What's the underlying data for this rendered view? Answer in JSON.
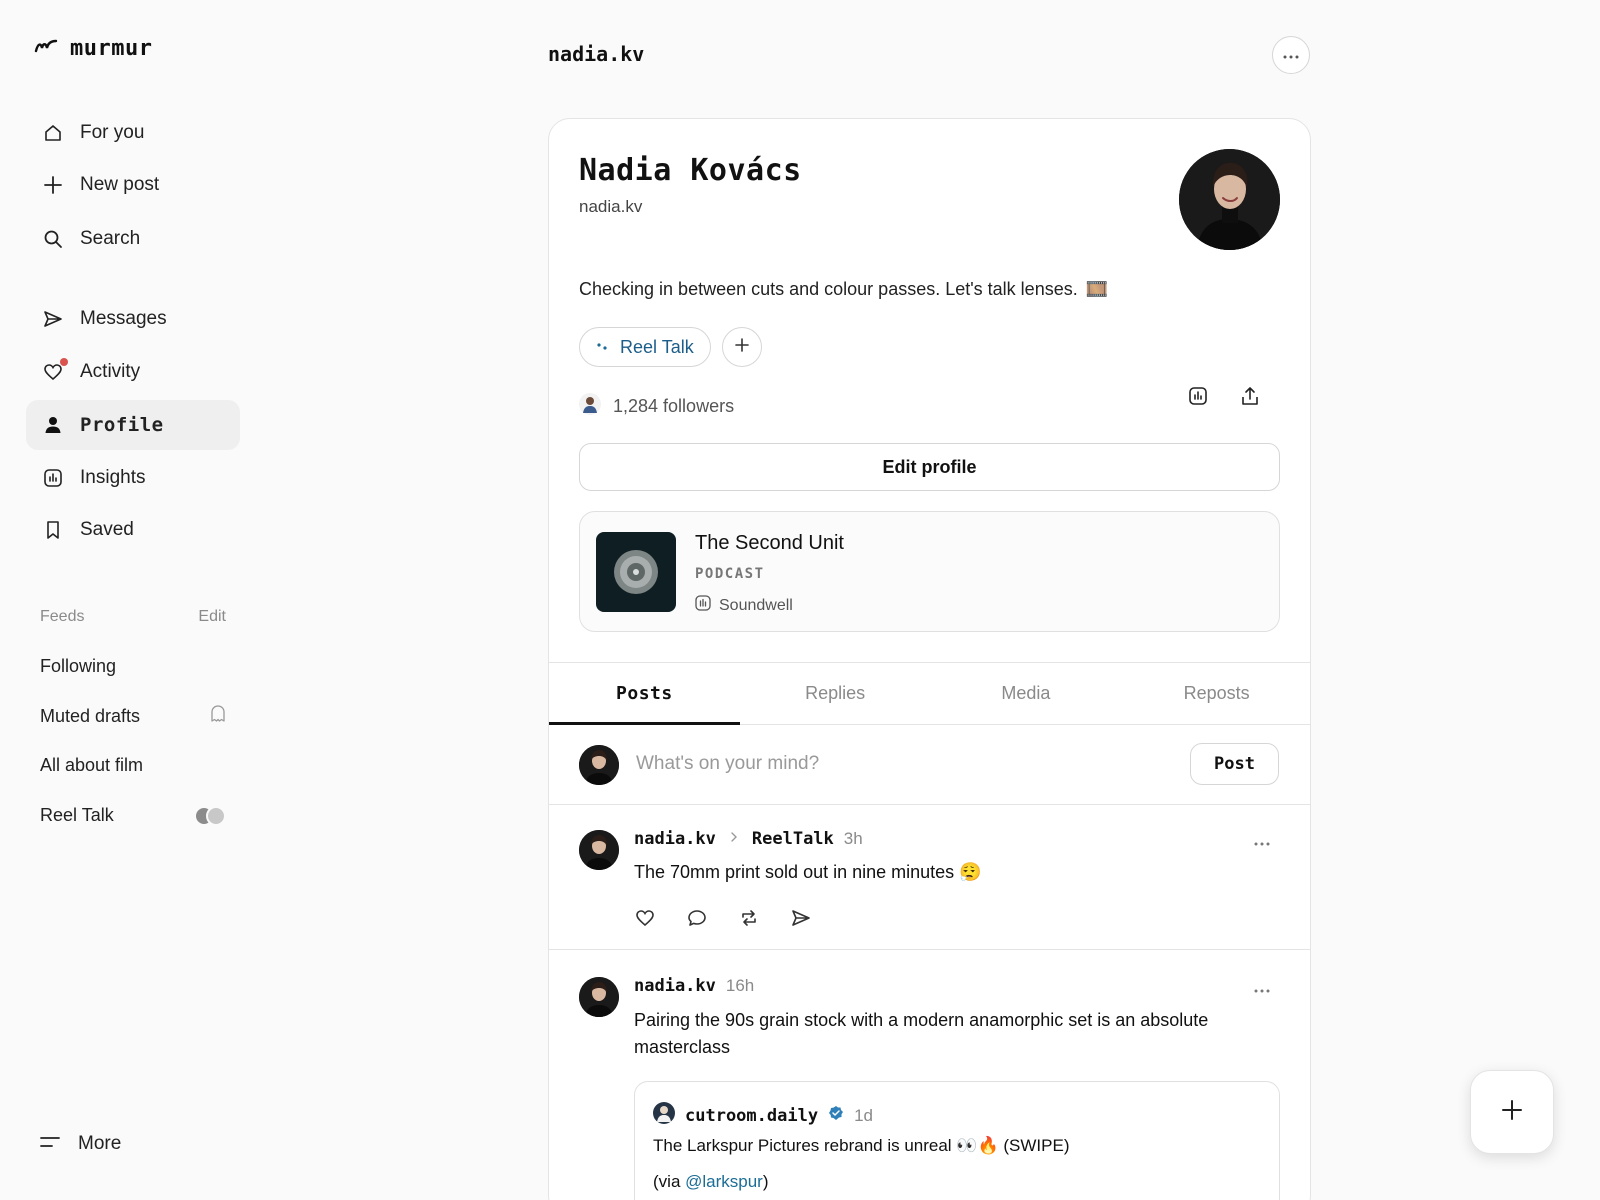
{
  "app": {
    "name": "murmur"
  },
  "nav": {
    "items": [
      {
        "label": "For you",
        "icon": "home-icon"
      },
      {
        "label": "New post",
        "icon": "plus-icon"
      },
      {
        "label": "Search",
        "icon": "search-icon"
      },
      {
        "label": "Messages",
        "icon": "send-icon"
      },
      {
        "label": "Activity",
        "icon": "heart-icon",
        "has_notification": true
      },
      {
        "label": "Profile",
        "icon": "person-icon",
        "active": true
      },
      {
        "label": "Insights",
        "icon": "chart-icon"
      },
      {
        "label": "Saved",
        "icon": "bookmark-icon"
      }
    ]
  },
  "feeds": {
    "heading": "Feeds",
    "edit_label": "Edit",
    "items": [
      {
        "label": "Following"
      },
      {
        "label": "Muted drafts",
        "icon": "ghost-icon"
      },
      {
        "label": "All about film"
      },
      {
        "label": "Reel Talk",
        "icon": "member-avatars"
      }
    ]
  },
  "more_label": "More",
  "header": {
    "handle": "nadia.kv"
  },
  "profile": {
    "name": "Nadia Kovács",
    "handle": "nadia.kv",
    "bio": "Checking in between cuts and colour passes. Let's talk lenses.",
    "bio_emoji": "🎞️",
    "community_chip": "Reel Talk",
    "followers": "1,284 followers",
    "edit_label": "Edit profile"
  },
  "podcast": {
    "title": "The Second Unit",
    "type": "PODCAST",
    "source": "Soundwell"
  },
  "tabs": [
    {
      "label": "Posts",
      "active": true
    },
    {
      "label": "Replies"
    },
    {
      "label": "Media"
    },
    {
      "label": "Reposts"
    }
  ],
  "composer": {
    "placeholder": "What's on your mind?",
    "post_label": "Post"
  },
  "posts": [
    {
      "user": "nadia.kv",
      "community": "ReelTalk",
      "time": "3h",
      "text": "The 70mm print sold out in nine minutes 😮‍💨"
    },
    {
      "user": "nadia.kv",
      "time": "16h",
      "text": "Pairing the 90s grain stock with a modern anamorphic set is an absolute masterclass",
      "quote": {
        "user": "cutroom.daily",
        "verified": true,
        "time": "1d",
        "text": "The Larkspur Pictures rebrand is unreal 👀🔥 (SWIPE)",
        "via_prefix": "(via ",
        "via_link": "@larkspur",
        "via_suffix": ")"
      }
    }
  ],
  "colors": {
    "link": "#1b6d96",
    "notification": "#d9534f",
    "active_bg": "#efefef"
  }
}
